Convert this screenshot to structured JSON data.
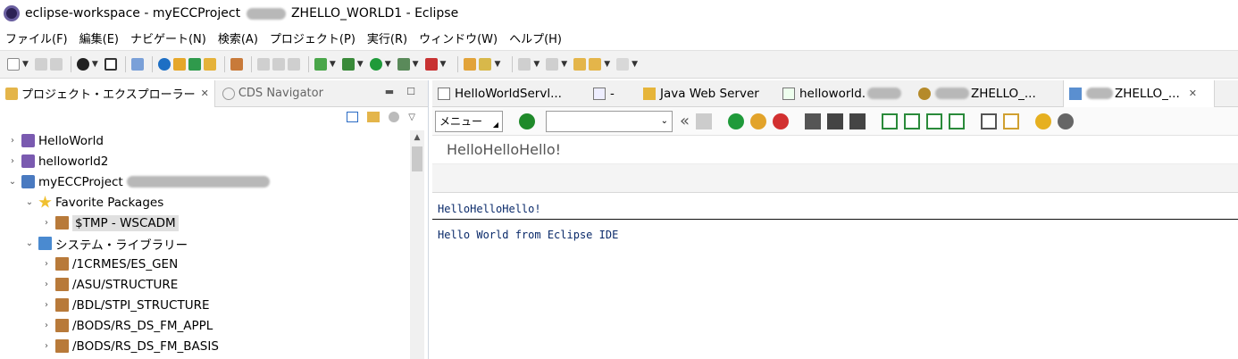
{
  "window": {
    "title_prefix": "eclipse-workspace - myECCProject",
    "title_suffix": "ZHELLO_WORLD1 - Eclipse"
  },
  "menubar": {
    "items": [
      "ファイル(F)",
      "編集(E)",
      "ナビゲート(N)",
      "検索(A)",
      "プロジェクト(P)",
      "実行(R)",
      "ウィンドウ(W)",
      "ヘルプ(H)"
    ]
  },
  "left_panel": {
    "tab_active": "プロジェクト・エクスプローラー",
    "tab_inactive": "CDS Navigator",
    "tree": [
      {
        "label": "HelloWorld",
        "twisty": "›",
        "level": 0,
        "icon": "project-icon"
      },
      {
        "label": "helloworld2",
        "twisty": "›",
        "level": 0,
        "icon": "project-icon"
      },
      {
        "label": "myECCProject",
        "twisty": "⌄",
        "level": 0,
        "icon": "abap-project-icon"
      },
      {
        "label": "Favorite Packages",
        "twisty": "⌄",
        "level": 1,
        "icon": "star-icon"
      },
      {
        "label": "$TMP - WSCADM",
        "twisty": "›",
        "level": 2,
        "icon": "package-icon",
        "selected": true
      },
      {
        "label": "システム・ライブラリー",
        "twisty": "⌄",
        "level": 1,
        "icon": "library-icon"
      },
      {
        "label": "/1CRMES/ES_GEN",
        "twisty": "›",
        "level": 2,
        "icon": "package-icon"
      },
      {
        "label": "/ASU/STRUCTURE",
        "twisty": "›",
        "level": 2,
        "icon": "package-icon"
      },
      {
        "label": "/BDL/STPI_STRUCTURE",
        "twisty": "›",
        "level": 2,
        "icon": "package-icon"
      },
      {
        "label": "/BODS/RS_DS_FM_APPL",
        "twisty": "›",
        "level": 2,
        "icon": "package-icon"
      },
      {
        "label": "/BODS/RS_DS_FM_BASIS",
        "twisty": "›",
        "level": 2,
        "icon": "package-icon"
      }
    ]
  },
  "editor_tabs": [
    {
      "label": "HelloWorldServl...",
      "icon": "java-file-icon"
    },
    {
      "label": "-",
      "icon": "file-icon"
    },
    {
      "label": "Java Web Server",
      "icon": "server-icon"
    },
    {
      "label": "helloworld.",
      "icon": "file-icon"
    },
    {
      "label": "ZHELLO_...",
      "icon": "abap-program-icon"
    },
    {
      "label": "ZHELLO_...",
      "icon": "sap-gui-icon",
      "active": true
    }
  ],
  "sap": {
    "menu_label": "メニュー",
    "screen_title": "HelloHelloHello!",
    "output_header": "HelloHelloHello!",
    "output_line": "Hello World from Eclipse IDE"
  }
}
